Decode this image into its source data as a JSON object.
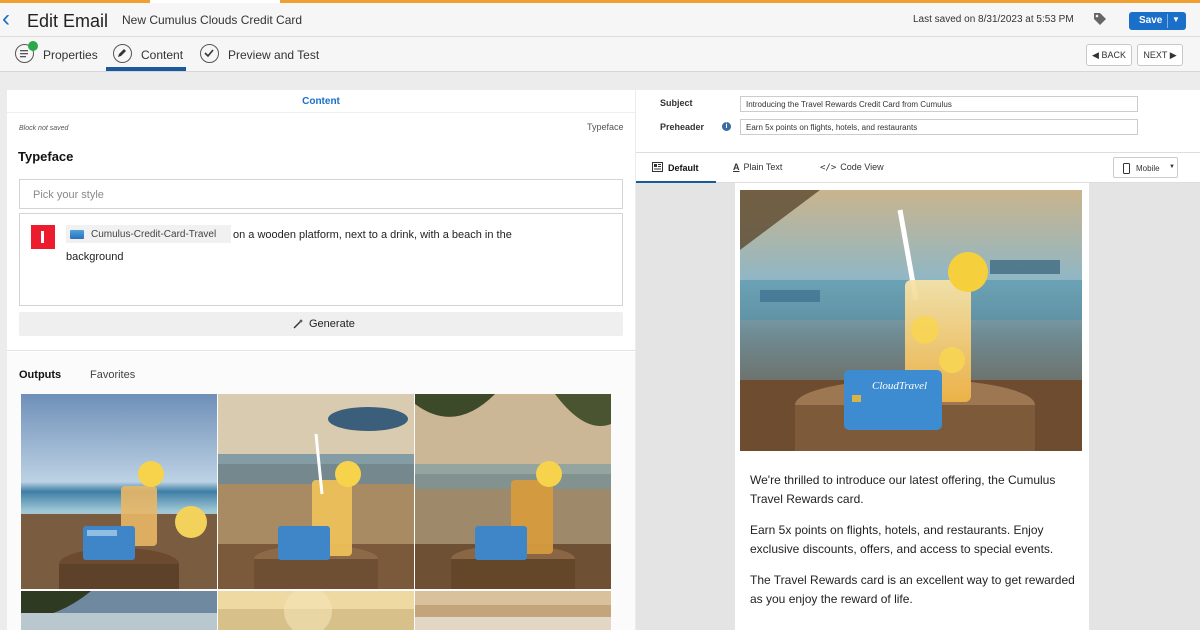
{
  "header": {
    "title": "Edit Email",
    "email_name": "New Cumulus Clouds Credit Card",
    "last_saved": "Last saved on 8/31/2023 at 5:53 PM",
    "save_label": "Save"
  },
  "tabs": {
    "items": [
      {
        "label": "Properties",
        "icon": "properties-icon"
      },
      {
        "label": "Content",
        "icon": "pencil-icon"
      },
      {
        "label": "Preview and Test",
        "icon": "check-icon"
      }
    ],
    "active": "Content",
    "back_label": "BACK",
    "next_label": "NEXT"
  },
  "left_panel": {
    "header": "Content",
    "block_status": "Block not saved",
    "block_type": "Typeface",
    "section_title": "Typeface",
    "style_placeholder": "Pick your style",
    "prompt": {
      "chip_label": "Cumulus-Credit-Card-Travel",
      "text_line1": "on a wooden platform, next to a drink, with a beach in the",
      "text_line2": "background"
    },
    "generate_label": "Generate",
    "output_tabs": [
      "Outputs",
      "Favorites"
    ]
  },
  "right_panel": {
    "subject_label": "Subject",
    "subject_value": "Introducing the Travel Rewards Credit Card from Cumulus",
    "preheader_label": "Preheader",
    "preheader_value": "Earn 5x points on flights, hotels, and restaurants",
    "view_tabs": [
      "Default",
      "Plain Text",
      "Code View"
    ],
    "active_view": "Default",
    "device_select": "Mobile",
    "card_brand": "CloudTravel",
    "body": [
      "We're thrilled to introduce our latest offering, the Cumulus Travel Rewards card.",
      "Earn 5x points on flights, hotels, and restaurants. Enjoy exclusive discounts, offers, and access to special events.",
      "The Travel Rewards card is an excellent way to get rewarded as you enjoy the reward of life."
    ]
  },
  "colors": {
    "accent": "#1a6fc9",
    "active_tab_underline": "#1a5a9c",
    "brand_red": "#ec1b2e",
    "progress_orange": "#f0a030"
  }
}
